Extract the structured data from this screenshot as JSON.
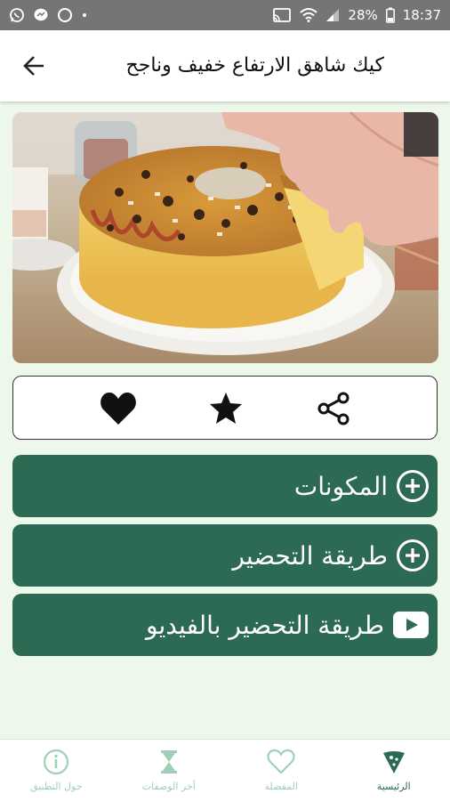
{
  "status_bar": {
    "battery": "28%",
    "time": "18:37",
    "icons": [
      "whatsapp-icon",
      "messenger-icon",
      "circle-icon",
      "dot-icon",
      "cast-icon",
      "wifi-icon",
      "signal-icon",
      "battery-icon"
    ]
  },
  "app_bar": {
    "title": "كيك شاهق الارتفاع خفيف وناجح",
    "back_icon": "arrow-back-icon"
  },
  "actions": {
    "icons": [
      "heart-icon",
      "star-icon",
      "share-icon"
    ]
  },
  "sections": [
    {
      "label": "المكونات",
      "icon": "add-circle-icon"
    },
    {
      "label": "طريقة التحضير",
      "icon": "add-circle-icon"
    },
    {
      "label": "طريقة التحضير بالفيديو",
      "icon": "youtube-icon"
    }
  ],
  "bottom_nav": [
    {
      "label": "الرئيسية",
      "icon": "pizza-slice-icon",
      "active": true
    },
    {
      "label": "المفضلة",
      "icon": "heart-outline-icon",
      "active": false
    },
    {
      "label": "أخر الوصفات",
      "icon": "hourglass-icon",
      "active": false
    },
    {
      "label": "حول التطبيق",
      "icon": "info-icon",
      "active": false
    }
  ],
  "colors": {
    "accent": "#2d6a54",
    "background": "#eef8ea",
    "nav_inactive": "#9fd0b7",
    "status_bar": "#757575"
  }
}
